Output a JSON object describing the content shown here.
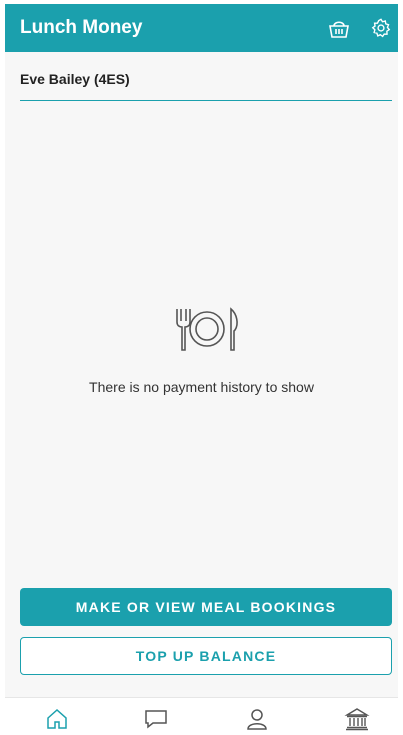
{
  "appbar": {
    "title": "Lunch Money",
    "accent_color": "#1ba0ad",
    "icons": [
      "basket-icon",
      "gear-icon"
    ]
  },
  "child_selector": {
    "value": "Eve Bailey (4ES)"
  },
  "empty_state": {
    "icon": "plate-cutlery-icon",
    "message": "There is no payment history to show"
  },
  "actions": {
    "meal_bookings_label": "MAKE OR VIEW MEAL BOOKINGS",
    "top_up_label": "TOP UP BALANCE"
  },
  "bottom_nav": {
    "items": [
      {
        "icon": "home-icon",
        "active": true
      },
      {
        "icon": "chat-icon",
        "active": false
      },
      {
        "icon": "profile-icon",
        "active": false
      },
      {
        "icon": "bank-icon",
        "active": false
      }
    ]
  }
}
